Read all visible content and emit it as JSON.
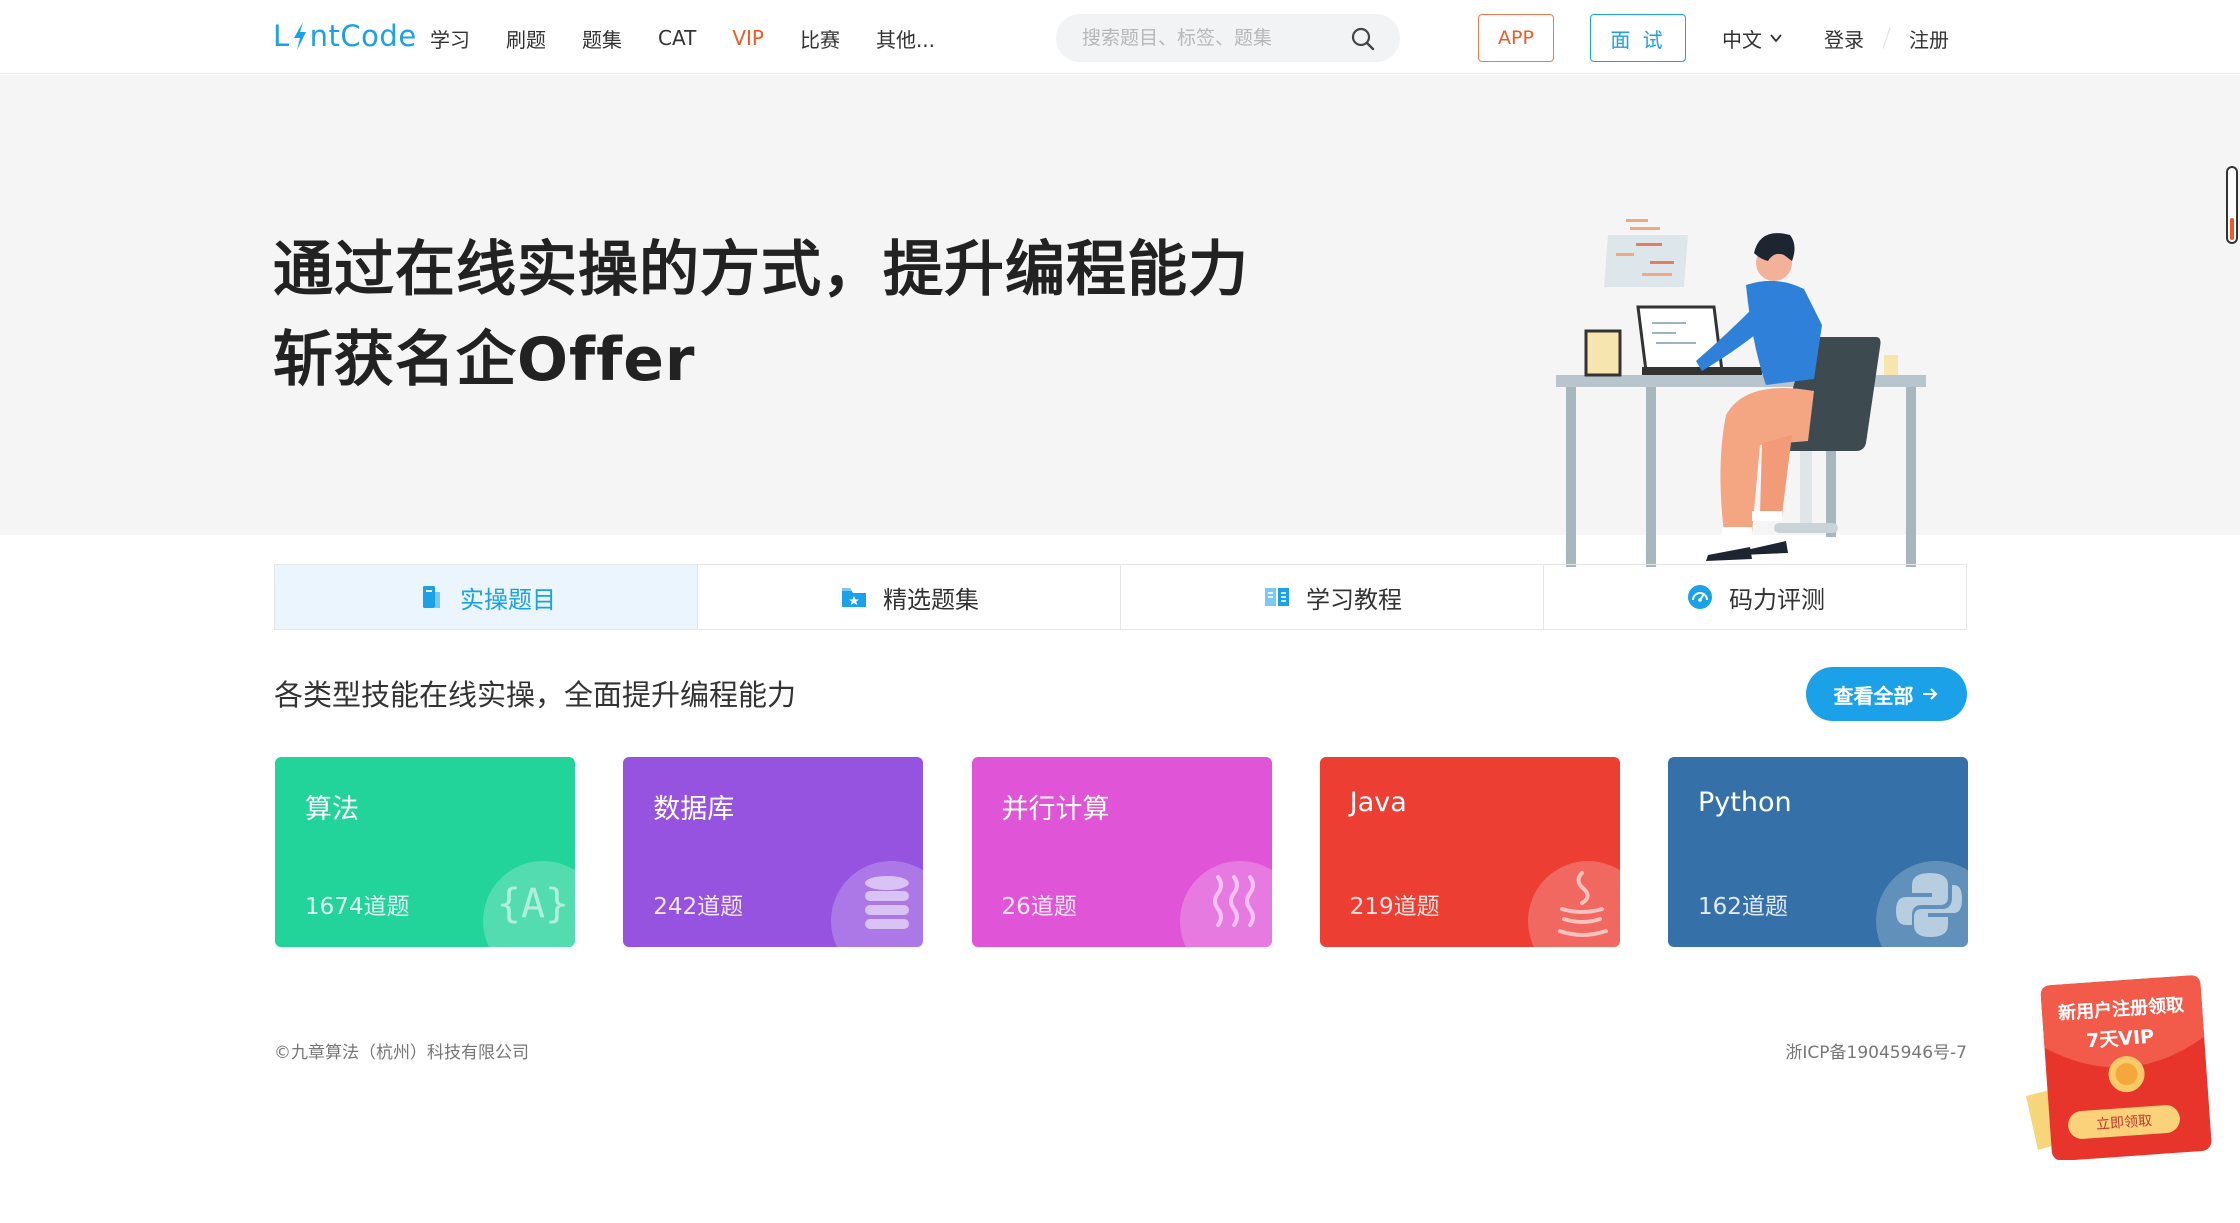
{
  "header": {
    "logo_before": "L",
    "logo_after": "ntCode",
    "nav": [
      "学习",
      "刷题",
      "题集",
      "CAT",
      "VIP",
      "比赛",
      "其他..."
    ],
    "search_placeholder": "搜索题目、标签、题集",
    "app_label": "APP",
    "interview_label": "面 试",
    "lang_label": "中文",
    "login_label": "登录",
    "register_label": "注册"
  },
  "hero": {
    "line1": "通过在线实操的方式，提升编程能力",
    "line2": "斩获名企Offer"
  },
  "tabs": [
    "实操题目",
    "精选题集",
    "学习教程",
    "码力评测"
  ],
  "section": {
    "title": "各类型技能在线实操，全面提升编程能力",
    "view_all": "查看全部"
  },
  "cards": [
    {
      "name": "算法",
      "count": "1674道题",
      "color": "#22d39a"
    },
    {
      "name": "数据库",
      "count": "242道题",
      "color": "#9553e0"
    },
    {
      "name": "并行计算",
      "count": "26道题",
      "color": "#e055d8"
    },
    {
      "name": "Java",
      "count": "219道题",
      "color": "#ec3e32"
    },
    {
      "name": "Python",
      "count": "162道题",
      "color": "#3571a8"
    }
  ],
  "footer": {
    "copyright": "©九章算法（杭州）科技有限公司",
    "icp": "浙ICP备19045946号-7"
  },
  "promo": {
    "line1": "新用户注册领取",
    "line2": "7天VIP",
    "button": "立即领取"
  },
  "colors": {
    "brand": "#1aa1e8",
    "vip": "#f05a28",
    "hero_bg": "#f5f5f5"
  },
  "icons": {
    "search": "search-icon",
    "chevron": "chevron-down-icon",
    "arrow": "arrow-right-icon"
  }
}
